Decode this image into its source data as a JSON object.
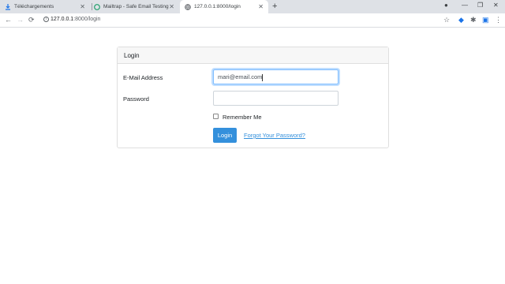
{
  "browser": {
    "tabs": [
      {
        "title": "Téléchargements",
        "icon": "download-icon"
      },
      {
        "title": "Mailtrap - Safe Email Testing",
        "icon": "mailtrap-icon"
      },
      {
        "title": "127.0.0.1:8000/login",
        "icon": "globe-icon"
      }
    ],
    "url_host": "127.0.0.1",
    "url_path": ":8000/login"
  },
  "card": {
    "header": "Login",
    "email_label": "E-Mail Address",
    "email_value": "mari@email.com",
    "password_label": "Password",
    "password_value": "",
    "remember_label": "Remember Me",
    "login_button": "Login",
    "forgot_link": "Forgot Your Password?"
  },
  "colors": {
    "accent": "#3490dc"
  }
}
